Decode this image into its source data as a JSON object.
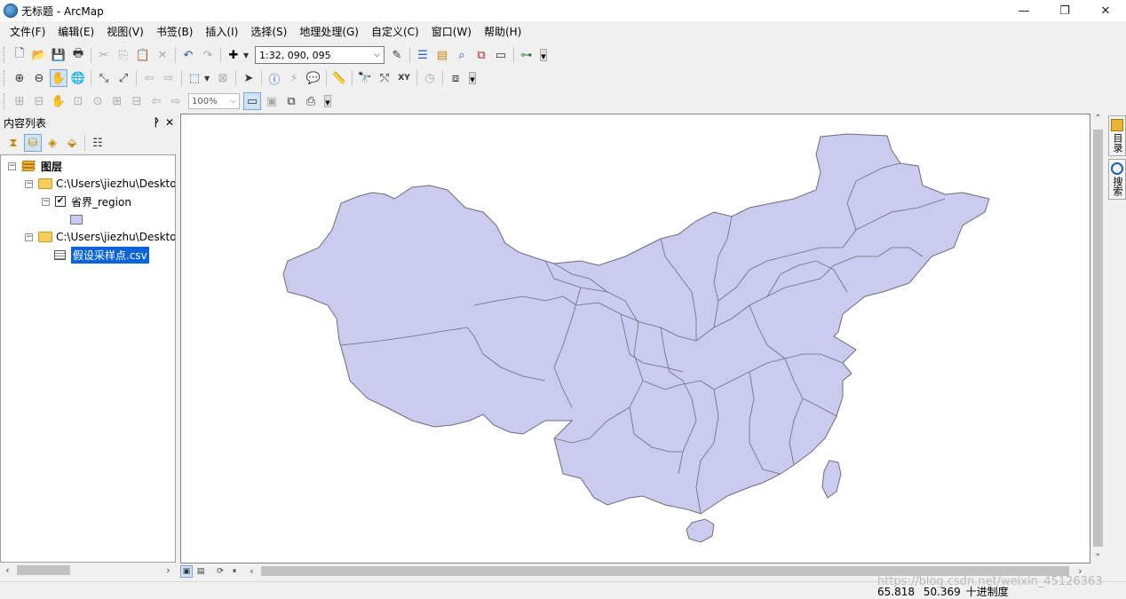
{
  "window": {
    "title": "无标题 - ArcMap",
    "minimize": "—",
    "restore": "❐",
    "close": "✕"
  },
  "menu": [
    "文件(F)",
    "编辑(E)",
    "视图(V)",
    "书签(B)",
    "插入(I)",
    "选择(S)",
    "地理处理(G)",
    "自定义(C)",
    "窗口(W)",
    "帮助(H)"
  ],
  "toolbar": {
    "scale_value": "1:32, 090, 095",
    "zoom_value": "100%"
  },
  "toc": {
    "title": "内容列表",
    "pin": "ᵖ",
    "close": "✕",
    "root_label": "图层",
    "items": [
      {
        "label": "C:\\Users\\jiezhu\\Deskto",
        "type": "folder"
      },
      {
        "label": "省界_region",
        "type": "layer",
        "checked": true
      },
      {
        "label": "C:\\Users\\jiezhu\\Deskto",
        "type": "folder"
      },
      {
        "label": "假设采样点.csv",
        "type": "table",
        "selected": true
      }
    ]
  },
  "side_tabs": [
    "目录",
    "搜索"
  ],
  "status": {
    "x": "65.818",
    "y": "50.369",
    "units": "十进制度"
  },
  "watermark": "https://blog.csdn.net/weixin_45126363",
  "colors": {
    "province_fill": "#cbcaef",
    "province_stroke": "#6c6c7c",
    "selection": "#0a64d8"
  }
}
